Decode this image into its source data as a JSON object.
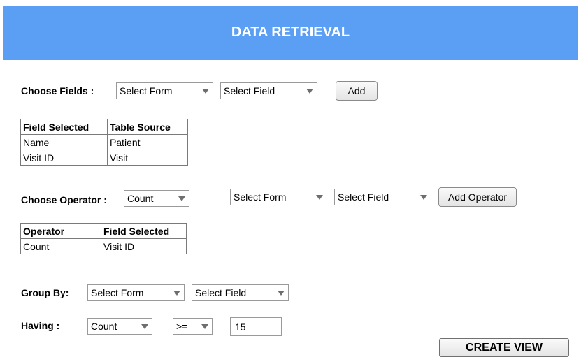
{
  "header": {
    "title": "DATA RETRIEVAL"
  },
  "choose_fields": {
    "label": "Choose Fields :",
    "form_select": "Select Form",
    "field_select": "Select Field",
    "add_button": "Add"
  },
  "fields_table": {
    "headers": [
      "Field Selected",
      "Table Source"
    ],
    "rows": [
      [
        "Name",
        "Patient"
      ],
      [
        "Visit ID",
        "Visit"
      ]
    ]
  },
  "choose_operator": {
    "label": "Choose Operator :",
    "operator_select": "Count",
    "form_select": "Select Form",
    "field_select": "Select Field",
    "add_button": "Add Operator"
  },
  "operator_table": {
    "headers": [
      "Operator",
      "Field Selected"
    ],
    "rows": [
      [
        "Count",
        "Visit ID"
      ]
    ]
  },
  "group_by": {
    "label": "Group By:",
    "form_select": "Select Form",
    "field_select": "Select Field"
  },
  "having": {
    "label": "Having :",
    "operator_select": "Count",
    "comparison_select": ">=",
    "value": "15"
  },
  "create_view_button": "CREATE VIEW",
  "colors": {
    "header_bg": "#5b9ff5",
    "header_text": "#ffffff"
  }
}
